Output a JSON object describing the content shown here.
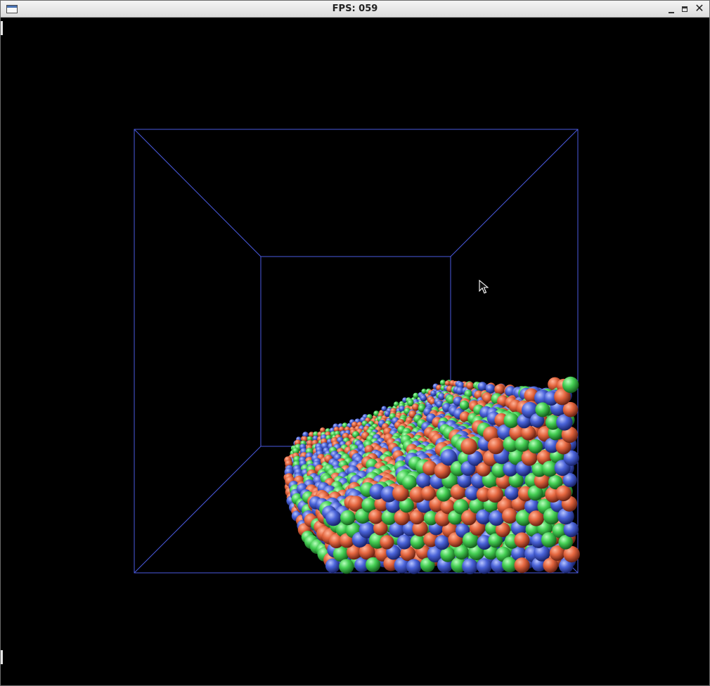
{
  "window": {
    "title": "FPS: 059",
    "close_glyph": "✕"
  },
  "icons": {
    "app": "window-app-icon",
    "minimize": "minimize-icon",
    "maximize": "maximize-icon",
    "close": "close-icon",
    "cursor": "mouse-pointer-icon"
  },
  "colors": {
    "background": "#000000",
    "box_edges": "#4a5adf",
    "particle_red": "#e4663f",
    "particle_green": "#45cf54",
    "particle_blue": "#4a63d8"
  },
  "scene": {
    "description_type": "particle-fluid-simulation",
    "particle_colors": [
      "red",
      "green",
      "blue"
    ]
  }
}
